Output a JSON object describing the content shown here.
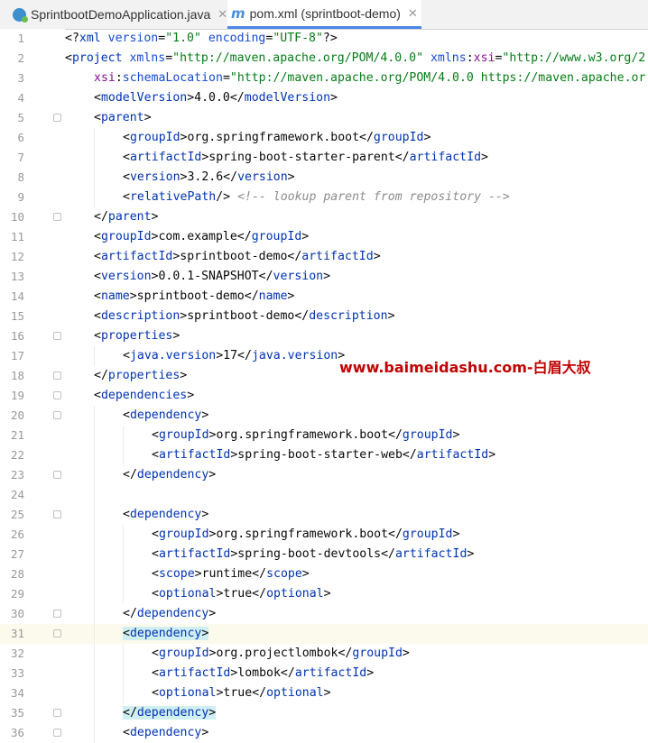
{
  "tabs": [
    {
      "label": "SprintbootDemoApplication.java",
      "icon": "java-class-icon",
      "active": false
    },
    {
      "label": "pom.xml (sprintboot-demo)",
      "icon": "maven-icon",
      "active": true
    }
  ],
  "watermark": "www.baimeidashu.com-白眉大叔",
  "lines": [
    {
      "n": "1",
      "indent": 0,
      "parts": [
        [
          "t",
          "<?"
        ],
        [
          "tag",
          "xml"
        ],
        [
          "t",
          " "
        ],
        [
          "attr",
          "version"
        ],
        [
          "t",
          "="
        ],
        [
          "str",
          "\"1.0\""
        ],
        [
          "t",
          " "
        ],
        [
          "attr",
          "encoding"
        ],
        [
          "t",
          "="
        ],
        [
          "str",
          "\"UTF-8\""
        ],
        [
          "t",
          "?>"
        ]
      ]
    },
    {
      "n": "2",
      "indent": 0,
      "parts": [
        [
          "t",
          "<"
        ],
        [
          "tag",
          "project"
        ],
        [
          "t",
          " "
        ],
        [
          "attr",
          "xmlns"
        ],
        [
          "t",
          "="
        ],
        [
          "str",
          "\"http://maven.apache.org/POM/4.0.0\""
        ],
        [
          "t",
          " "
        ],
        [
          "attr",
          "xmlns"
        ],
        [
          "t",
          ":"
        ],
        [
          "ns",
          "xsi"
        ],
        [
          "t",
          "="
        ],
        [
          "str",
          "\"http://www.w3.org/2"
        ]
      ]
    },
    {
      "n": "3",
      "indent": 1,
      "parts": [
        [
          "ns",
          "xsi"
        ],
        [
          "t",
          ":"
        ],
        [
          "attr",
          "schemaLocation"
        ],
        [
          "t",
          "="
        ],
        [
          "str",
          "\"http://maven.apache.org/POM/4.0.0 https://maven.apache.or"
        ]
      ]
    },
    {
      "n": "4",
      "indent": 1,
      "parts": [
        [
          "t",
          "<"
        ],
        [
          "tag",
          "modelVersion"
        ],
        [
          "t",
          ">4.0.0</"
        ],
        [
          "tag",
          "modelVersion"
        ],
        [
          "t",
          ">"
        ]
      ]
    },
    {
      "n": "5",
      "indent": 1,
      "fold": true,
      "parts": [
        [
          "t",
          "<"
        ],
        [
          "tag",
          "parent"
        ],
        [
          "t",
          ">"
        ]
      ]
    },
    {
      "n": "6",
      "indent": 2,
      "parts": [
        [
          "t",
          "<"
        ],
        [
          "tag",
          "groupId"
        ],
        [
          "t",
          ">org.springframework.boot</"
        ],
        [
          "tag",
          "groupId"
        ],
        [
          "t",
          ">"
        ]
      ]
    },
    {
      "n": "7",
      "indent": 2,
      "parts": [
        [
          "t",
          "<"
        ],
        [
          "tag",
          "artifactId"
        ],
        [
          "t",
          ">spring-boot-starter-parent</"
        ],
        [
          "tag",
          "artifactId"
        ],
        [
          "t",
          ">"
        ]
      ]
    },
    {
      "n": "8",
      "indent": 2,
      "parts": [
        [
          "t",
          "<"
        ],
        [
          "tag",
          "version"
        ],
        [
          "t",
          ">3.2.6</"
        ],
        [
          "tag",
          "version"
        ],
        [
          "t",
          ">"
        ]
      ]
    },
    {
      "n": "9",
      "indent": 2,
      "parts": [
        [
          "t",
          "<"
        ],
        [
          "tag",
          "relativePath"
        ],
        [
          "t",
          "/> "
        ],
        [
          "cmt",
          "<!-- lookup parent from repository -->"
        ]
      ]
    },
    {
      "n": "10",
      "indent": 1,
      "fold": true,
      "parts": [
        [
          "t",
          "</"
        ],
        [
          "tag",
          "parent"
        ],
        [
          "t",
          ">"
        ]
      ]
    },
    {
      "n": "11",
      "indent": 1,
      "parts": [
        [
          "t",
          "<"
        ],
        [
          "tag",
          "groupId"
        ],
        [
          "t",
          ">com.example</"
        ],
        [
          "tag",
          "groupId"
        ],
        [
          "t",
          ">"
        ]
      ]
    },
    {
      "n": "12",
      "indent": 1,
      "parts": [
        [
          "t",
          "<"
        ],
        [
          "tag",
          "artifactId"
        ],
        [
          "t",
          ">sprintboot-demo</"
        ],
        [
          "tag",
          "artifactId"
        ],
        [
          "t",
          ">"
        ]
      ]
    },
    {
      "n": "13",
      "indent": 1,
      "parts": [
        [
          "t",
          "<"
        ],
        [
          "tag",
          "version"
        ],
        [
          "t",
          ">0.0.1-SNAPSHOT</"
        ],
        [
          "tag",
          "version"
        ],
        [
          "t",
          ">"
        ]
      ]
    },
    {
      "n": "14",
      "indent": 1,
      "parts": [
        [
          "t",
          "<"
        ],
        [
          "tag",
          "name"
        ],
        [
          "t",
          ">sprintboot-demo</"
        ],
        [
          "tag",
          "name"
        ],
        [
          "t",
          ">"
        ]
      ]
    },
    {
      "n": "15",
      "indent": 1,
      "parts": [
        [
          "t",
          "<"
        ],
        [
          "tag",
          "description"
        ],
        [
          "t",
          ">sprintboot-demo</"
        ],
        [
          "tag",
          "description"
        ],
        [
          "t",
          ">"
        ]
      ]
    },
    {
      "n": "16",
      "indent": 1,
      "fold": true,
      "parts": [
        [
          "t",
          "<"
        ],
        [
          "tag",
          "properties"
        ],
        [
          "t",
          ">"
        ]
      ]
    },
    {
      "n": "17",
      "indent": 2,
      "parts": [
        [
          "t",
          "<"
        ],
        [
          "tag",
          "java.version"
        ],
        [
          "t",
          ">17</"
        ],
        [
          "tag",
          "java.version"
        ],
        [
          "t",
          ">"
        ]
      ]
    },
    {
      "n": "18",
      "indent": 1,
      "fold": true,
      "parts": [
        [
          "t",
          "</"
        ],
        [
          "tag",
          "properties"
        ],
        [
          "t",
          ">"
        ]
      ]
    },
    {
      "n": "19",
      "indent": 1,
      "fold": true,
      "parts": [
        [
          "t",
          "<"
        ],
        [
          "tag",
          "dependencies"
        ],
        [
          "t",
          ">"
        ]
      ]
    },
    {
      "n": "20",
      "indent": 2,
      "fold": true,
      "parts": [
        [
          "t",
          "<"
        ],
        [
          "tag",
          "dependency"
        ],
        [
          "t",
          ">"
        ]
      ]
    },
    {
      "n": "21",
      "indent": 3,
      "parts": [
        [
          "t",
          "<"
        ],
        [
          "tag",
          "groupId"
        ],
        [
          "t",
          ">org.springframework.boot</"
        ],
        [
          "tag",
          "groupId"
        ],
        [
          "t",
          ">"
        ]
      ]
    },
    {
      "n": "22",
      "indent": 3,
      "parts": [
        [
          "t",
          "<"
        ],
        [
          "tag",
          "artifactId"
        ],
        [
          "t",
          ">spring-boot-starter-web</"
        ],
        [
          "tag",
          "artifactId"
        ],
        [
          "t",
          ">"
        ]
      ]
    },
    {
      "n": "23",
      "indent": 2,
      "fold": true,
      "parts": [
        [
          "t",
          "</"
        ],
        [
          "tag",
          "dependency"
        ],
        [
          "t",
          ">"
        ]
      ]
    },
    {
      "n": "24",
      "indent": 2,
      "parts": []
    },
    {
      "n": "25",
      "indent": 2,
      "fold": true,
      "parts": [
        [
          "t",
          "<"
        ],
        [
          "tag",
          "dependency"
        ],
        [
          "t",
          ">"
        ]
      ]
    },
    {
      "n": "26",
      "indent": 3,
      "parts": [
        [
          "t",
          "<"
        ],
        [
          "tag",
          "groupId"
        ],
        [
          "t",
          ">org.springframework.boot</"
        ],
        [
          "tag",
          "groupId"
        ],
        [
          "t",
          ">"
        ]
      ]
    },
    {
      "n": "27",
      "indent": 3,
      "parts": [
        [
          "t",
          "<"
        ],
        [
          "tag",
          "artifactId"
        ],
        [
          "t",
          ">spring-boot-devtools</"
        ],
        [
          "tag",
          "artifactId"
        ],
        [
          "t",
          ">"
        ]
      ]
    },
    {
      "n": "28",
      "indent": 3,
      "parts": [
        [
          "t",
          "<"
        ],
        [
          "tag",
          "scope"
        ],
        [
          "t",
          ">runtime</"
        ],
        [
          "tag",
          "scope"
        ],
        [
          "t",
          ">"
        ]
      ]
    },
    {
      "n": "29",
      "indent": 3,
      "parts": [
        [
          "t",
          "<"
        ],
        [
          "tag",
          "optional"
        ],
        [
          "t",
          ">true</"
        ],
        [
          "tag",
          "optional"
        ],
        [
          "t",
          ">"
        ]
      ]
    },
    {
      "n": "30",
      "indent": 2,
      "fold": true,
      "parts": [
        [
          "t",
          "</"
        ],
        [
          "tag",
          "dependency"
        ],
        [
          "t",
          ">"
        ]
      ]
    },
    {
      "n": "31",
      "indent": 2,
      "fold": true,
      "caret": true,
      "parts": [
        [
          "hlt",
          "<"
        ],
        [
          "hltag",
          "dependency"
        ],
        [
          "hlt",
          ">"
        ]
      ]
    },
    {
      "n": "32",
      "indent": 3,
      "parts": [
        [
          "t",
          "<"
        ],
        [
          "tag",
          "groupId"
        ],
        [
          "t",
          ">org.projectlombok</"
        ],
        [
          "tag",
          "groupId"
        ],
        [
          "t",
          ">"
        ]
      ]
    },
    {
      "n": "33",
      "indent": 3,
      "parts": [
        [
          "t",
          "<"
        ],
        [
          "tag",
          "artifactId"
        ],
        [
          "t",
          ">lombok</"
        ],
        [
          "tag",
          "artifactId"
        ],
        [
          "t",
          ">"
        ]
      ]
    },
    {
      "n": "34",
      "indent": 3,
      "parts": [
        [
          "t",
          "<"
        ],
        [
          "tag",
          "optional"
        ],
        [
          "t",
          ">true</"
        ],
        [
          "tag",
          "optional"
        ],
        [
          "t",
          ">"
        ]
      ]
    },
    {
      "n": "35",
      "indent": 2,
      "fold": true,
      "parts": [
        [
          "hlt",
          "</"
        ],
        [
          "hltag",
          "dependency"
        ],
        [
          "hlt",
          ">"
        ]
      ]
    },
    {
      "n": "36",
      "indent": 2,
      "fold": true,
      "parts": [
        [
          "t",
          "<"
        ],
        [
          "tag",
          "dependency"
        ],
        [
          "t",
          ">"
        ]
      ]
    }
  ]
}
